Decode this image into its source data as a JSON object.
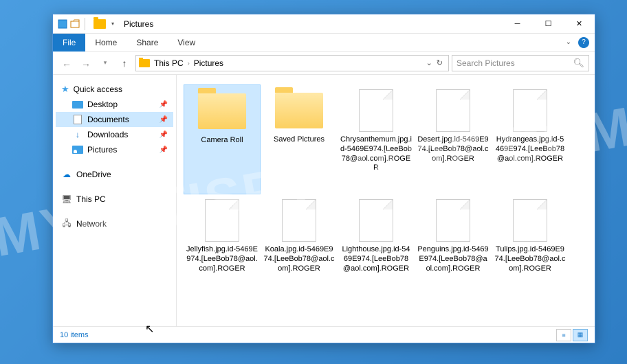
{
  "window": {
    "title": "Pictures"
  },
  "ribbon": {
    "tabs": [
      "File",
      "Home",
      "Share",
      "View"
    ]
  },
  "address": {
    "segments": [
      "This PC",
      "Pictures"
    ]
  },
  "search": {
    "placeholder": "Search Pictures"
  },
  "navpane": {
    "quick_access": {
      "label": "Quick access",
      "items": [
        {
          "label": "Desktop",
          "icon": "desktop",
          "pinned": true
        },
        {
          "label": "Documents",
          "icon": "doc",
          "pinned": true,
          "selected": true
        },
        {
          "label": "Downloads",
          "icon": "down",
          "pinned": true
        },
        {
          "label": "Pictures",
          "icon": "pic",
          "pinned": true
        }
      ]
    },
    "onedrive": {
      "label": "OneDrive"
    },
    "thispc": {
      "label": "This PC"
    },
    "network": {
      "label": "Network"
    }
  },
  "items": [
    {
      "type": "folder",
      "label": "Camera Roll",
      "selected": true
    },
    {
      "type": "folder",
      "label": "Saved Pictures"
    },
    {
      "type": "file",
      "label": "Chrysanthemum.jpg.id-5469E974.[LeeBob78@aol.com].ROGER"
    },
    {
      "type": "file",
      "label": "Desert.jpg.id-5469E974.[LeeBob78@aol.com].ROGER"
    },
    {
      "type": "file",
      "label": "Hydrangeas.jpg.id-5469E974.[LeeBob78@aol.com].ROGER"
    },
    {
      "type": "file",
      "label": "Jellyfish.jpg.id-5469E974.[LeeBob78@aol.com].ROGER"
    },
    {
      "type": "file",
      "label": "Koala.jpg.id-5469E974.[LeeBob78@aol.com].ROGER"
    },
    {
      "type": "file",
      "label": "Lighthouse.jpg.id-5469E974.[LeeBob78@aol.com].ROGER"
    },
    {
      "type": "file",
      "label": "Penguins.jpg.id-5469E974.[LeeBob78@aol.com].ROGER"
    },
    {
      "type": "file",
      "label": "Tulips.jpg.id-5469E974.[LeeBob78@aol.com].ROGER"
    }
  ],
  "status": {
    "count_label": "10 items"
  },
  "watermark": "MYANTISPYWARE.COM"
}
